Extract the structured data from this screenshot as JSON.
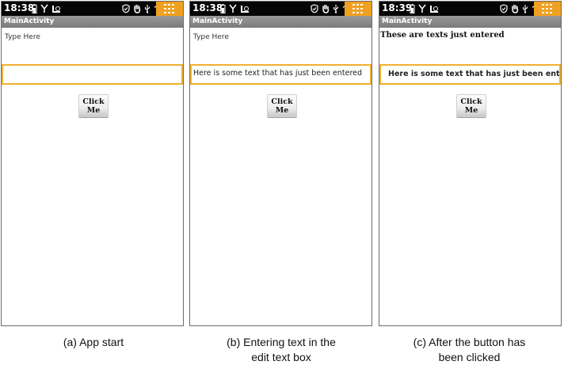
{
  "status_time": [
    "18:38",
    "18:38",
    "18:39"
  ],
  "app_title": "MainActivity",
  "phone_a": {
    "textview": "Type Here",
    "edit_value": "",
    "button_label": "Click Me",
    "caption": "(a) App start"
  },
  "phone_b": {
    "textview": "Type Here",
    "edit_value": "Here is some text that has just been entered",
    "button_label": "Click Me",
    "caption_line1": "(b) Entering text in the",
    "caption_line2": "edit text box"
  },
  "phone_c": {
    "textview": "These are texts just entered",
    "edit_value": "Here is some text that has just been entered",
    "button_label": "Click Me",
    "caption_line1": "(c) After the button has",
    "caption_line2": "been clicked"
  },
  "colors": {
    "status_bar": "#050505",
    "menu_accent": "#f0a020",
    "title_bar": "#8a8a8a",
    "edit_focus_border": "#f0b030"
  },
  "icons": {
    "status_left": [
      "battery-icon",
      "signal-icon",
      "usb-debug-icon"
    ],
    "status_right": [
      "shield-icon",
      "hand-icon",
      "usb-icon",
      "wifi-icon"
    ],
    "menu": "menu-grid-icon"
  }
}
